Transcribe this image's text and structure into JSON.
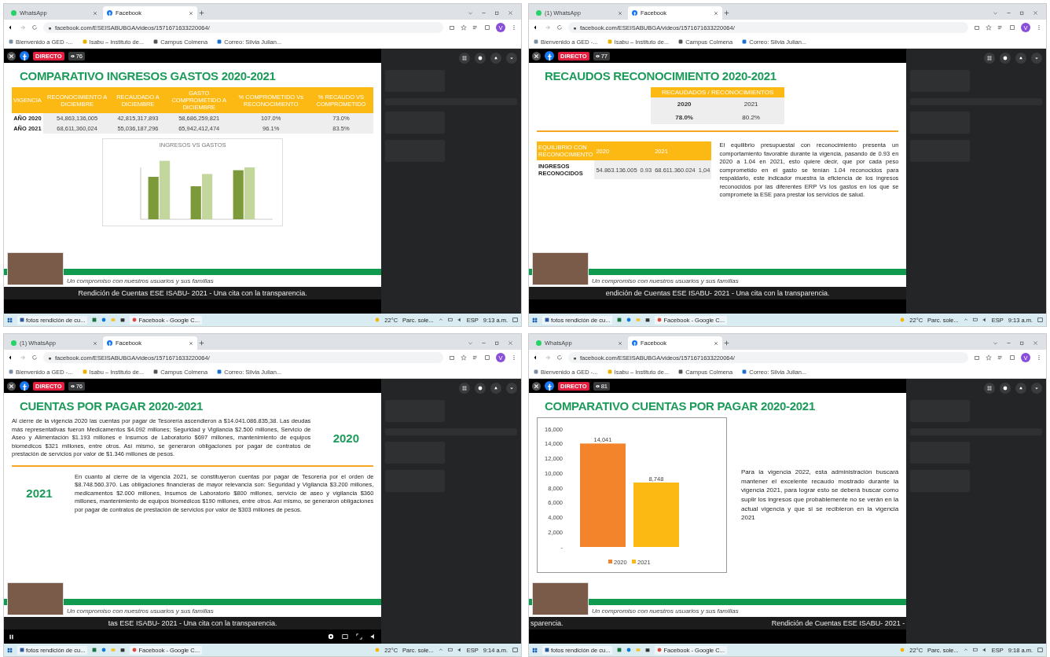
{
  "panels": [
    {
      "browser": {
        "tabs": [
          {
            "kind": "whatsapp",
            "label": "WhatsApp",
            "selected": false
          },
          {
            "kind": "facebook",
            "label": "Facebook",
            "selected": true
          }
        ],
        "url": "facebook.com/ESEISABUBGA/videos/1571671633220064/",
        "avatar_letter": "V",
        "bookmarks": [
          "Bienvenido a GED -...",
          "Isabu – Instituto de...",
          "Campus Colmena",
          "Correo: Silvia Julian..."
        ]
      },
      "live_badge": "DIRECTO",
      "viewers": "76",
      "slide": {
        "kind": "table_chart",
        "title": "COMPARATIVO INGRESOS GASTOS 2020-2021",
        "table": {
          "header": [
            "VIGENCIA",
            "RECONOCIMIENTO A DICIEMBRE",
            "RECAUDADO A DICIEMBRE",
            "GASTO COMPROMETIDO A DICIEMBRE",
            "% COMPROMETIDO Vs RECONOCIMIENTO",
            "% RECAUDO VS COMPROMETIDO"
          ],
          "rows": [
            [
              "AÑO 2020",
              "54,863,136,005",
              "42,815,317,893",
              "58,686,259,821",
              "107.0%",
              "73.0%"
            ],
            [
              "AÑO 2021",
              "68,611,360,024",
              "55,036,187,296",
              "65,942,412,474",
              "96.1%",
              "83.5%"
            ]
          ]
        },
        "chart_title": "INGRESOS VS GASTOS"
      },
      "motto": "Un compromiso con nuestros usuarios y sus familias",
      "ticker": [
        "Rendición de Cuentas ESE ISABU- 2021 - Una cita con la transparencia."
      ],
      "taskbar": {
        "apps": [
          "fotos rendición de cu...",
          "Facebook - Google C..."
        ],
        "temperature": "22°C",
        "weather": "Parc. sole...",
        "lang": "ESP",
        "time": "9:13 a.m."
      }
    },
    {
      "browser": {
        "tabs": [
          {
            "kind": "whatsapp",
            "label": "(1) WhatsApp",
            "selected": false
          },
          {
            "kind": "facebook",
            "label": "Facebook",
            "selected": true
          }
        ],
        "url": "facebook.com/ESEISABUBGA/videos/1571671633220064/",
        "avatar_letter": "V",
        "bookmarks": [
          "Bienvenido a GED -...",
          "Isabu – Instituto de...",
          "Campus Colmena",
          "Correo: Silvia Julian..."
        ]
      },
      "live_badge": "DIRECTO",
      "viewers": "77",
      "slide": {
        "kind": "ratios",
        "title": "RECAUDOS RECONOCIMIENTO 2020-2021",
        "ratio_table": {
          "header": "RECAUDADOS / RECONOCIMIENTOS",
          "rows": [
            [
              "2020",
              "2021"
            ],
            [
              "78.0%",
              "80.2%"
            ]
          ]
        },
        "balance_table": {
          "header": [
            "EQUILIBRIO CON RECONOCIMIENTO",
            "2020",
            "2021"
          ],
          "row": [
            "INGRESOS RECONOCIDOS",
            "54.863.136.005",
            "0.93",
            "68.611.360.024",
            "1,04"
          ]
        },
        "paragraph": "El equilibrio presupuestal con reconocimiento presenta un comportamiento favorable durante la vigencia, pasando de 0.93 en 2020 a 1.04 en 2021, esto quiere decir, que por cada peso comprometido en el gasto se tenían 1.04 reconocidos para respaldarlo, este indicador muestra la eficiencia de los ingresos reconocidos por las diferentes ERP Vs los gastos en los que se compromete la ESE para prestar los servicios de salud."
      },
      "motto": "Un compromiso con nuestros usuarios y sus familias",
      "ticker": [
        "endición de Cuentas ESE ISABU- 2021 - Una cita con la transparencia."
      ],
      "taskbar": {
        "apps": [
          "fotos rendición de cu...",
          "Facebook - Google C..."
        ],
        "temperature": "22°C",
        "weather": "Parc. sole...",
        "lang": "ESP",
        "time": "9:13 a.m."
      }
    },
    {
      "browser": {
        "tabs": [
          {
            "kind": "whatsapp",
            "label": "(1) WhatsApp",
            "selected": false
          },
          {
            "kind": "facebook",
            "label": "Facebook",
            "selected": true
          }
        ],
        "url": "facebook.com/ESEISABUBGA/videos/1571671633220064/",
        "avatar_letter": "V",
        "bookmarks": [
          "Bienvenido a GED -...",
          "Isabu – Instituto de...",
          "Campus Colmena",
          "Correo: Silvia Julian..."
        ]
      },
      "live_badge": "DIRECTO",
      "viewers": "76",
      "slide": {
        "kind": "text_years",
        "title": "CUENTAS POR PAGAR 2020-2021",
        "sections": [
          {
            "year": "2020",
            "text": "Al cierre de la vigencia 2020 las cuentas por pagar de Tesorería ascendieron a $14.041.086.835,38. Las deudas más representativas fueron Medicamentos $4.092 millones; Seguridad y Vigilancia $2.500 millones, Servicio de Aseo y Alimentación $1.193 millones e Insumos de Laboratorio $697 millones, mantenimiento de equipos biomédicos $321 millones, entre otros. Así mismo, se generaron obligaciones por pagar de contratos de prestación de servicios por valor de $1.346 millones de pesos."
          },
          {
            "year": "2021",
            "text": "En cuanto al cierre de la vigencia 2021, se constituyeron cuentas por pagar de Tesorería por el orden de $8.748.560.370. Las obligaciones financieras de mayor relevancia son: Seguridad y Vigilancia $3.200 millones, medicamentos $2.000 millones, Insumos de Laboratorio $800 millones, servicio de aseo y vigilancia $360 millones, mantenimiento de equipos biomédicos $190 millones, entre otros. Así mismo, se generaron obligaciones por pagar de contratos de prestación de servicios por valor de $303 millones de pesos."
          }
        ]
      },
      "motto": "Un compromiso con nuestros usuarios y sus familias",
      "ticker": [
        "tas ESE ISABU- 2021 - Una cita con la transparencia."
      ],
      "player_controls": true,
      "taskbar": {
        "apps": [
          "fotos rendición de cu...",
          "Facebook - Google C..."
        ],
        "temperature": "22°C",
        "weather": "Parc. sole...",
        "lang": "ESP",
        "time": "9:14 a.m."
      }
    },
    {
      "browser": {
        "tabs": [
          {
            "kind": "whatsapp",
            "label": "WhatsApp",
            "selected": false
          },
          {
            "kind": "facebook",
            "label": "Facebook",
            "selected": true
          }
        ],
        "url": "facebook.com/ESEISABUBGA/videos/1571671633220064/",
        "avatar_letter": "V",
        "bookmarks": [
          "Bienvenido a GED -...",
          "Isabu – Instituto de...",
          "Campus Colmena",
          "Correo: Silvia Julian..."
        ]
      },
      "live_badge": "DIRECTO",
      "viewers": "81",
      "slide": {
        "kind": "bar_chart",
        "title": "COMPARATIVO CUENTAS POR PAGAR 2020-2021",
        "chart_data": {
          "type": "bar",
          "series": [
            {
              "name": "2020",
              "color": "#f4842c",
              "values": [
                14041
              ]
            },
            {
              "name": "2021",
              "color": "#fcb813",
              "values": [
                8748
              ]
            }
          ],
          "ylim": [
            0,
            16000
          ],
          "yticks": [
            {
              "value": 0,
              "label": "-"
            },
            {
              "value": 2000,
              "label": "2,000"
            },
            {
              "value": 4000,
              "label": "4,000"
            },
            {
              "value": 6000,
              "label": "6,000"
            },
            {
              "value": 8000,
              "label": "8,000"
            },
            {
              "value": 10000,
              "label": "10,000"
            },
            {
              "value": 12000,
              "label": "12,000"
            },
            {
              "value": 14000,
              "label": "14,000"
            },
            {
              "value": 16000,
              "label": "16,000"
            }
          ],
          "value_labels": [
            "14,041",
            "8,748"
          ],
          "legend": "bottom"
        },
        "paragraph": "Para la vigencia 2022, esta administración buscará mantener el excelente recaudo mostrado durante la vigencia 2021, para lograr esto se deberá buscar como suplir los ingresos que probablemente no se verán en la actual vigencia y que si se recibieron en la vigencia 2021"
      },
      "motto": "Un compromiso con nuestros usuarios y sus familias",
      "ticker": [
        "sparencia.",
        "Rendición de Cuentas ESE ISABU- 2021 -"
      ],
      "taskbar": {
        "apps": [
          "fotos rendición de cu...",
          "Facebook - Google C..."
        ],
        "temperature": "22°C",
        "weather": "Parc. sole...",
        "lang": "ESP",
        "time": "9:18 a.m."
      }
    }
  ]
}
